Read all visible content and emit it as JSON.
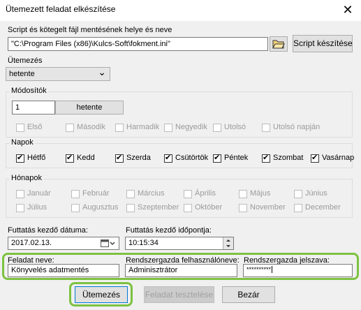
{
  "window": {
    "title": "Ütemezett feladat elkészítése",
    "close_glyph": "✕"
  },
  "script": {
    "label": "Script és kötegelt fájl mentésének helye és neve",
    "path": "\"C:\\Program Files (x86)\\Kulcs-Soft\\fokment.ini\"",
    "create_button": "Script készítése"
  },
  "schedule": {
    "label": "Ütemezés",
    "selected": "hetente",
    "chevron": "⌄"
  },
  "modifiers": {
    "legend": "Módosítók",
    "count_value": "1",
    "unit_button": "hetente",
    "options": [
      "Első",
      "Második",
      "Harmadik",
      "Negyedik",
      "Utolsó",
      "Utolsó napján"
    ]
  },
  "days": {
    "legend": "Napok",
    "items": [
      {
        "label": "Hétfő",
        "checked": true
      },
      {
        "label": "Kedd",
        "checked": true
      },
      {
        "label": "Szerda",
        "checked": true
      },
      {
        "label": "Csütörtök",
        "checked": true
      },
      {
        "label": "Péntek",
        "checked": true
      },
      {
        "label": "Szombat",
        "checked": true
      },
      {
        "label": "Vasárnap",
        "checked": true
      }
    ]
  },
  "months": {
    "legend": "Hónapok",
    "items": [
      "Január",
      "Február",
      "Március",
      "Április",
      "Május",
      "Június",
      "Július",
      "Augusztus",
      "Szeptember",
      "Október",
      "November",
      "December"
    ]
  },
  "start_date": {
    "label": "Futtatás kezdő dátuma:",
    "value": "2017.02.13."
  },
  "start_time": {
    "label": "Futtatás kezdő időpontja:",
    "value": "10:15:34"
  },
  "task_name": {
    "label": "Feladat neve:",
    "value": "Könyvelés adatmentés"
  },
  "admin_user": {
    "label": "Rendszergazda felhasználóneve:",
    "value": "Adminisztrátor"
  },
  "admin_password": {
    "label": "Rendszergazda jelszava:",
    "value": "**********"
  },
  "buttons": {
    "schedule": "Ütemezés",
    "test": "Feladat tesztelése",
    "close": "Bezár"
  },
  "accent_color": "#7dc242"
}
